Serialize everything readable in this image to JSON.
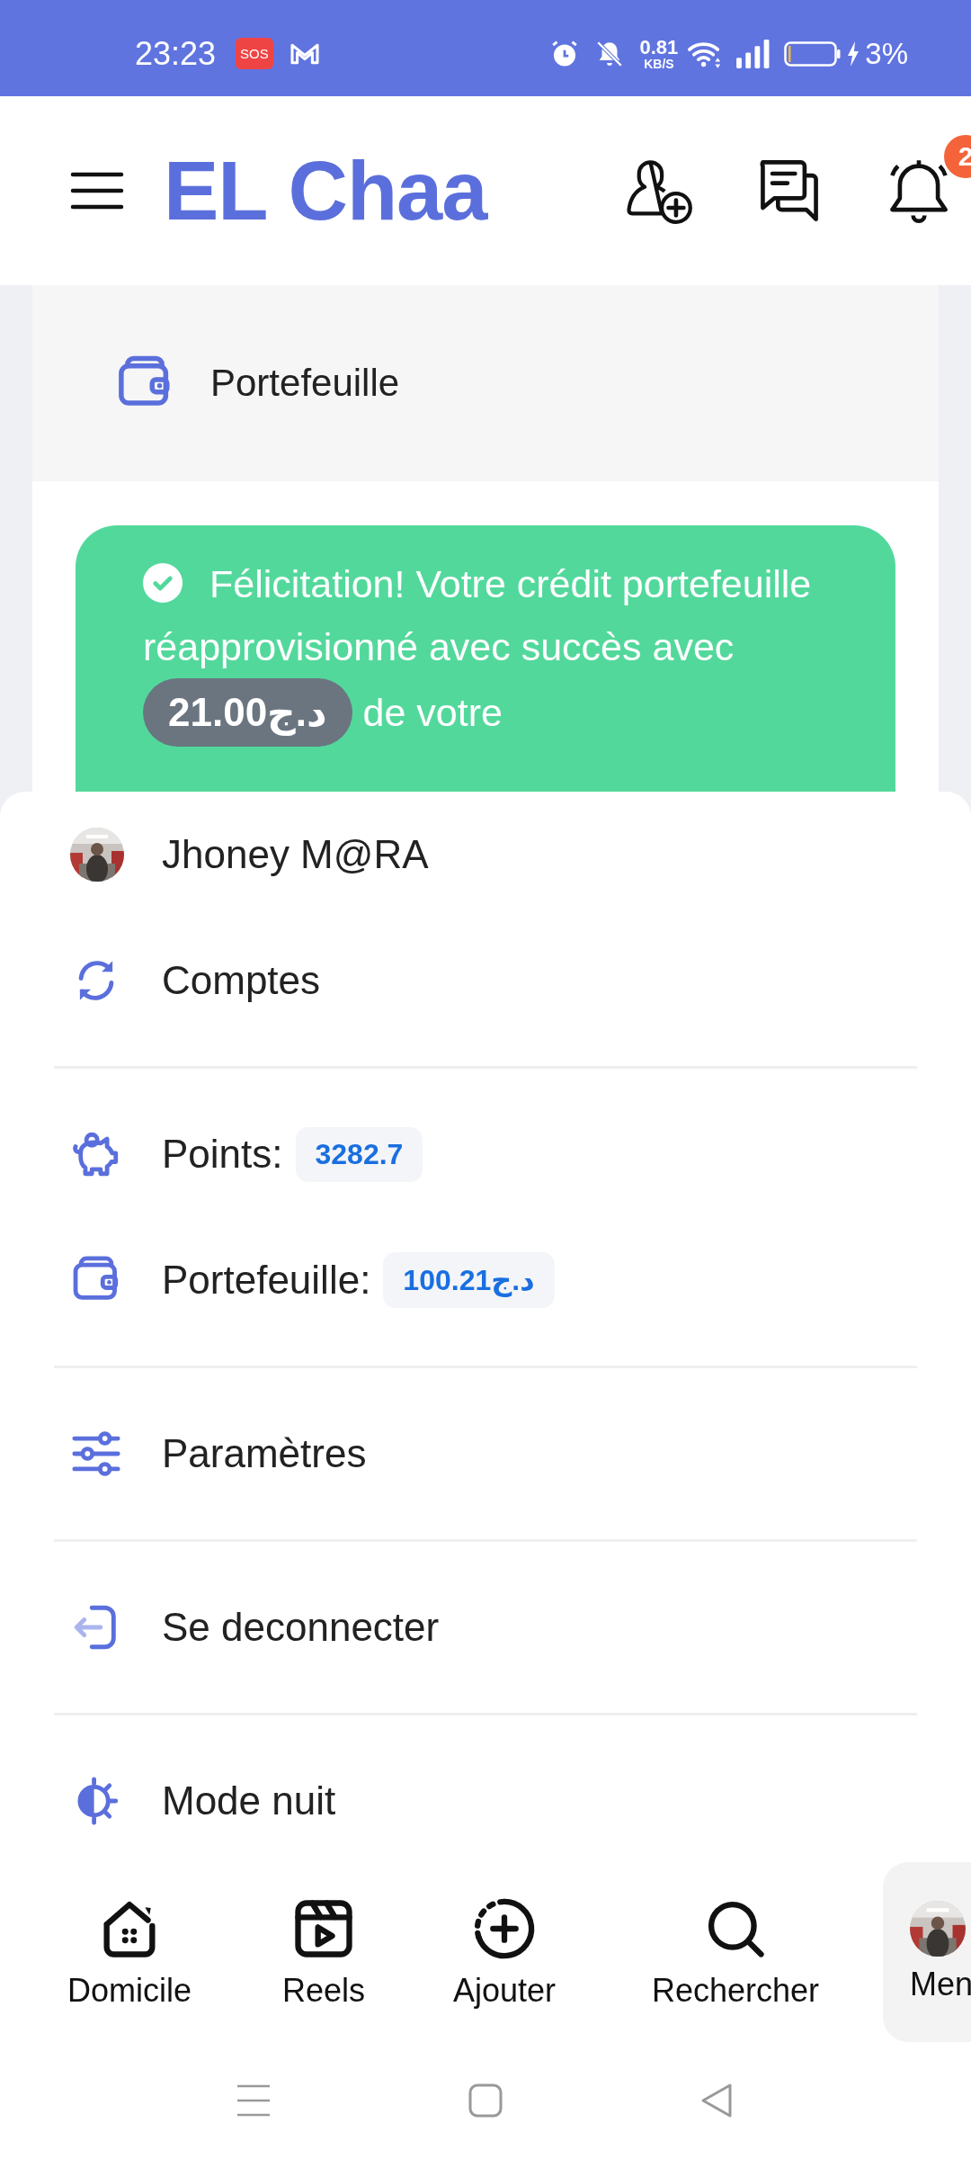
{
  "status_bar": {
    "time": "23:23",
    "sos": "SOS",
    "speed": "0.81",
    "speed_unit": "KB/S",
    "battery": "3%"
  },
  "header": {
    "title": "EL Chaa",
    "notification_count": "2"
  },
  "page": {
    "section_title": "Portefeuille",
    "alert": {
      "text": "Félicitation! Votre crédit portefeuille réapprovisionné avec succès avec",
      "amount": "21.00د.ج",
      "text_after": "de votre"
    }
  },
  "menu": {
    "groups": [
      [
        {
          "kind": "profile",
          "label": "Jhoney M@RA"
        },
        {
          "kind": "accounts",
          "label": "Comptes"
        }
      ],
      [
        {
          "kind": "points",
          "label": "Points:",
          "value": "3282.7"
        },
        {
          "kind": "wallet",
          "label": "Portefeuille:",
          "value": "100.21د.ج"
        }
      ],
      [
        {
          "kind": "settings",
          "label": "Paramètres"
        }
      ],
      [
        {
          "kind": "logout",
          "label": "Se deconnecter"
        }
      ],
      [
        {
          "kind": "night",
          "label": "Mode nuit"
        }
      ]
    ]
  },
  "bottom_nav": [
    {
      "kind": "home",
      "label": "Domicile",
      "selected": false
    },
    {
      "kind": "reels",
      "label": "Reels",
      "selected": false
    },
    {
      "kind": "add",
      "label": "Ajouter",
      "selected": false
    },
    {
      "kind": "search",
      "label": "Rechercher",
      "selected": false
    },
    {
      "kind": "avatar",
      "label": "Men",
      "selected": true
    }
  ]
}
